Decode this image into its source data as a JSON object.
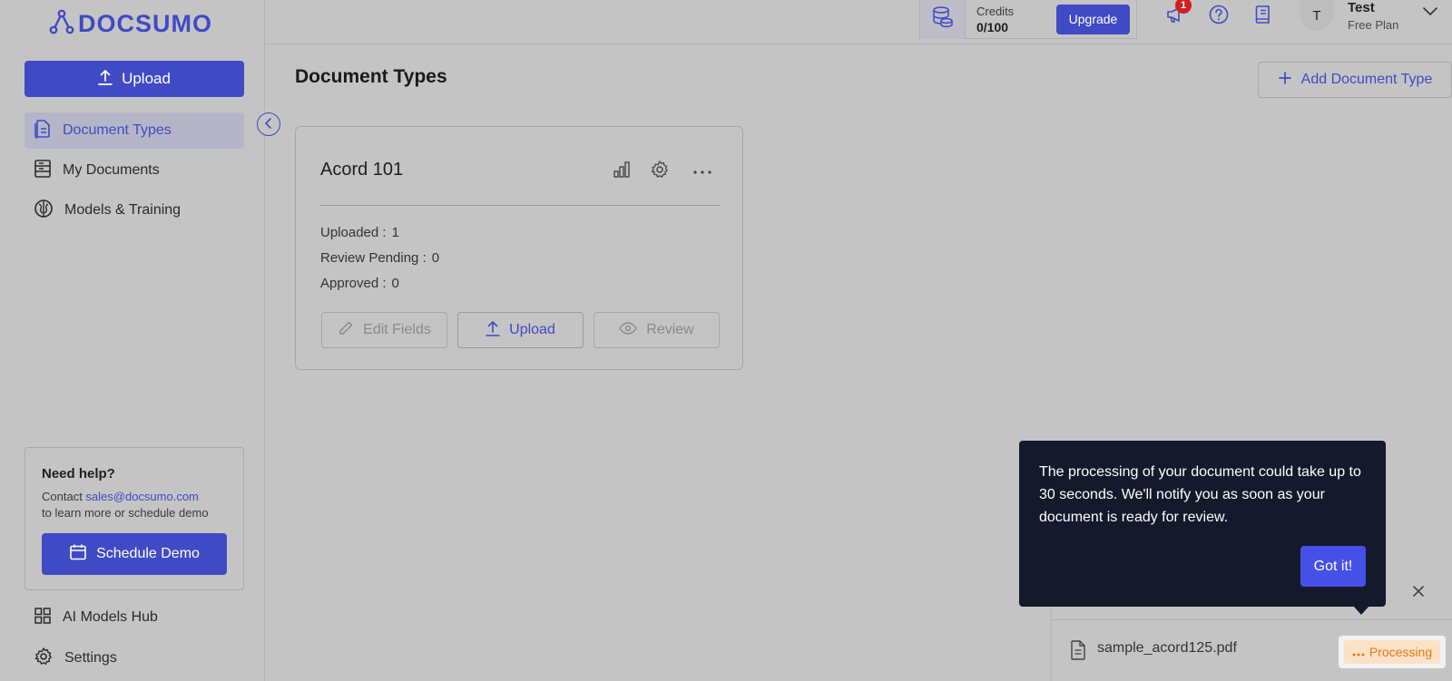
{
  "brand": {
    "name": "DOCSUMO"
  },
  "sidebar": {
    "upload_label": "Upload",
    "items": [
      {
        "label": "Document Types",
        "icon": "document-types-icon",
        "active": true
      },
      {
        "label": "My Documents",
        "icon": "my-documents-icon",
        "active": false
      },
      {
        "label": "Models & Training",
        "icon": "brain-icon",
        "active": false
      }
    ],
    "help": {
      "title": "Need help?",
      "contact_prefix": "Contact ",
      "email": "sales@docsumo.com",
      "contact_suffix": "to learn more or schedule demo",
      "demo_label": "Schedule Demo"
    },
    "bottom_items": [
      {
        "label": "AI Models Hub",
        "icon": "grid-icon"
      },
      {
        "label": "Settings",
        "icon": "gear-icon"
      }
    ]
  },
  "topbar": {
    "credits_label": "Credits",
    "credits_value": "0/100",
    "upgrade_label": "Upgrade",
    "notification_count": "1",
    "user_initial": "T",
    "user_name": "Test",
    "user_plan": "Free Plan"
  },
  "main": {
    "title": "Document Types",
    "add_label": "Add Document Type",
    "card": {
      "title": "Acord 101",
      "stats": [
        {
          "label": "Uploaded :",
          "value": "1"
        },
        {
          "label": "Review Pending :",
          "value": "0"
        },
        {
          "label": "Approved :",
          "value": "0"
        }
      ],
      "edit_label": "Edit Fields",
      "upload_label": "Upload",
      "review_label": "Review"
    }
  },
  "queue": {
    "file_name": "sample_acord125.pdf",
    "status": "Processing"
  },
  "tooltip": {
    "text": "The processing of your document could take up to 30 seconds. We'll notify you as soon as your document is ready for review.",
    "button": "Got it!"
  },
  "colors": {
    "accent": "#3f4bc4",
    "tooltip_bg": "#141a2b",
    "processing_bg": "#fbe2c6",
    "processing_text": "#e07d16",
    "badge": "#d21f1f"
  }
}
